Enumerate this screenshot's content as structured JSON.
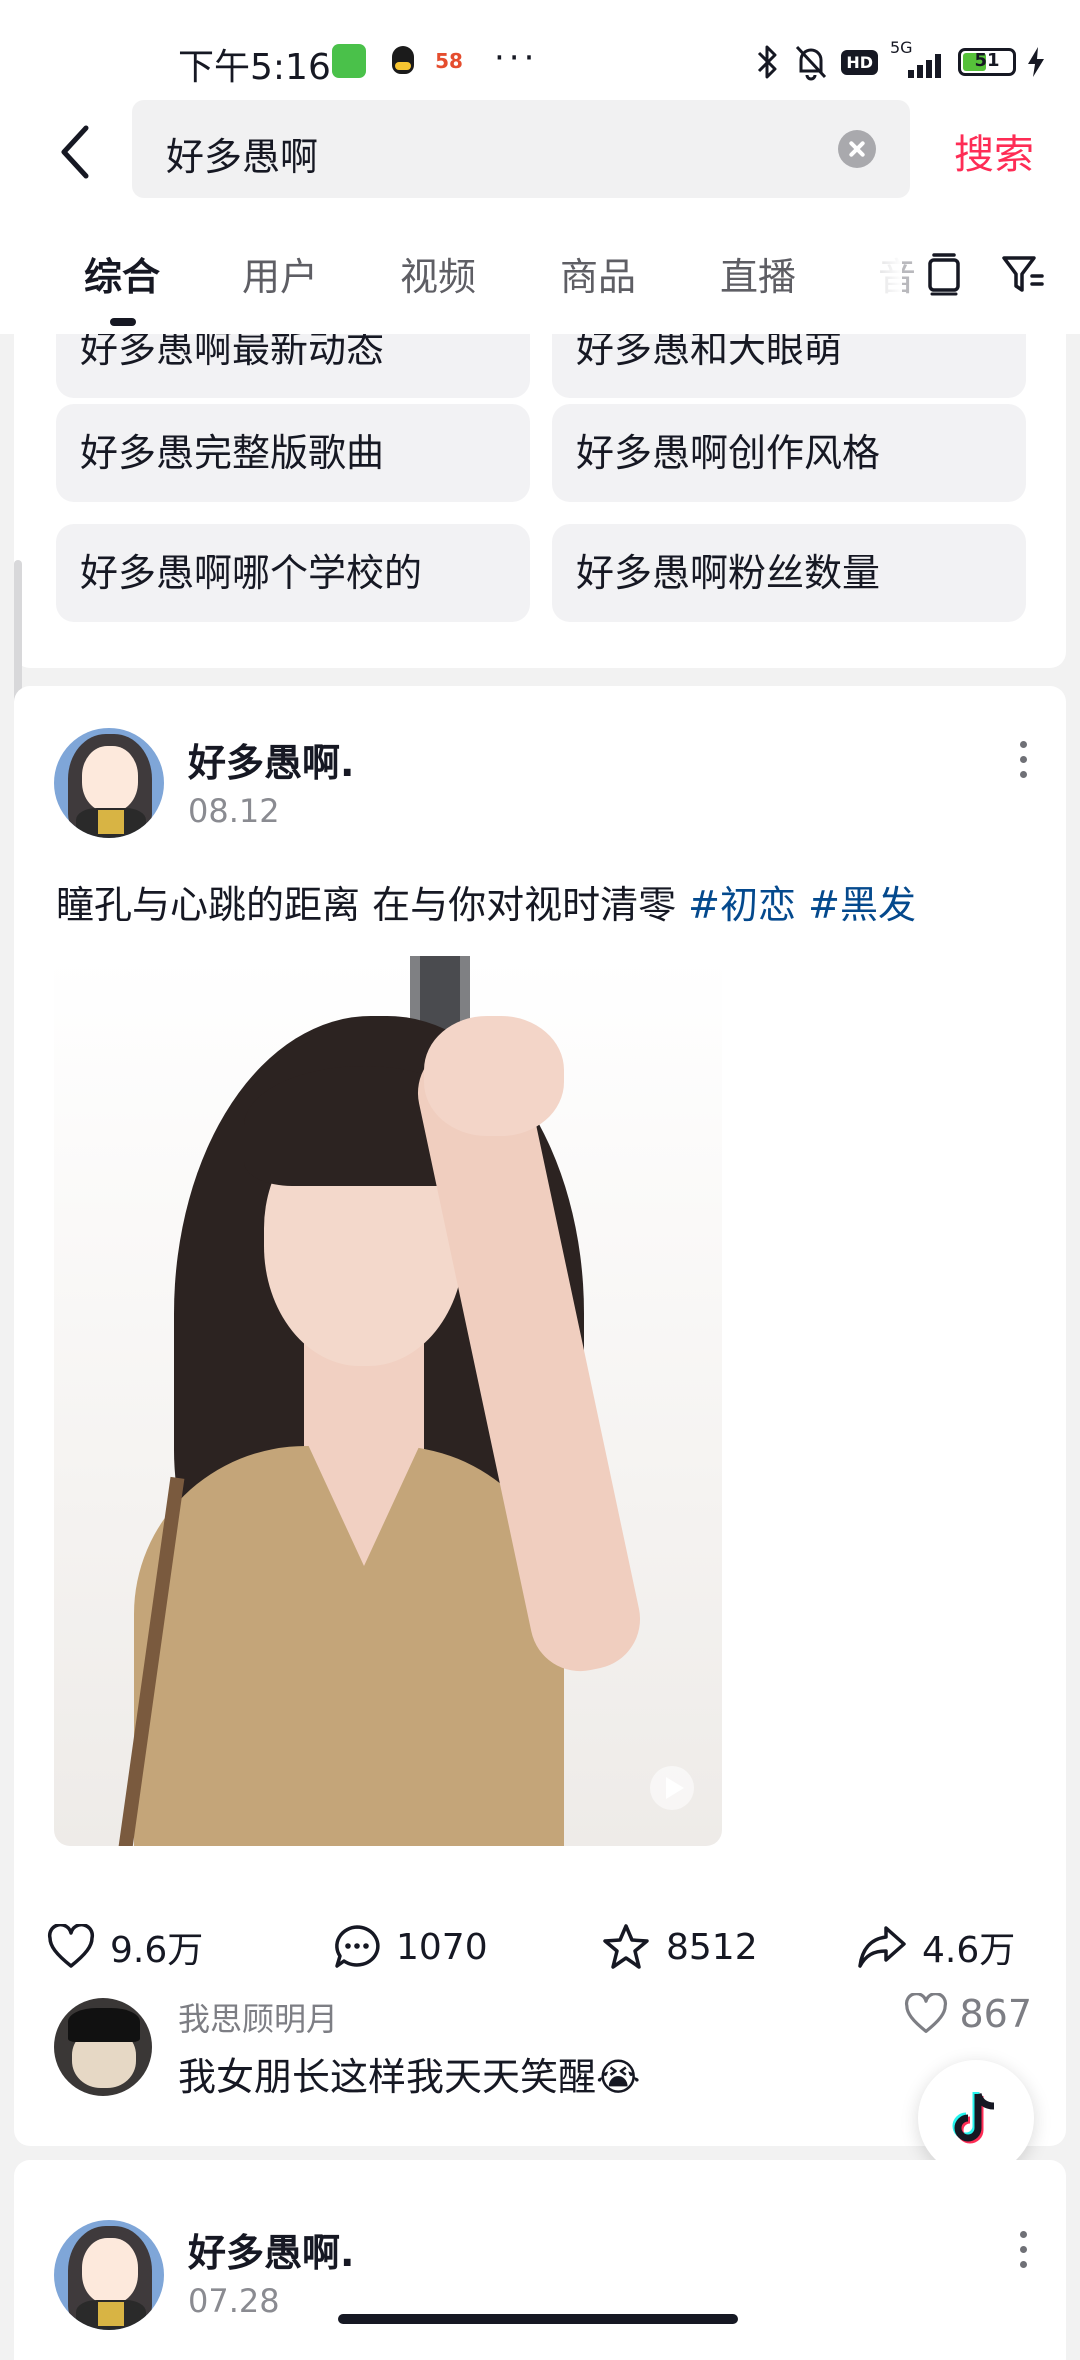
{
  "status_bar": {
    "time": "下午5:16",
    "app_58": "58",
    "more": "···",
    "hd": "HD",
    "network": "5G",
    "battery": "51",
    "battery_level_percent": 51
  },
  "search": {
    "query": "好多愚啊",
    "button": "搜索"
  },
  "tabs": [
    "综合",
    "用户",
    "视频",
    "商品",
    "直播",
    "音"
  ],
  "suggestions": [
    "好多愚啊最新动态",
    "好多愚和大眼萌",
    "好多愚完整版歌曲",
    "好多愚啊创作风格",
    "好多愚啊哪个学校的",
    "好多愚啊粉丝数量"
  ],
  "post": {
    "author": "好多愚啊.",
    "date": "08.12",
    "text": "瞳孔与心跳的距离 在与你对视时清零 ",
    "tags": [
      "#初恋",
      "#黑发"
    ],
    "stats": {
      "likes": "9.6万",
      "comments": "1070",
      "favorites": "8512",
      "shares": "4.6万"
    },
    "top_comment": {
      "user": "我思顾明月",
      "text": "我女朋长这样我天天笑醒😭",
      "likes": "867"
    }
  },
  "next_post": {
    "author": "好多愚啊.",
    "date": "07.28"
  },
  "colors": {
    "accent": "#fe2c55",
    "tag": "#04498d",
    "text": "#161823",
    "muted": "#8a8b91"
  }
}
